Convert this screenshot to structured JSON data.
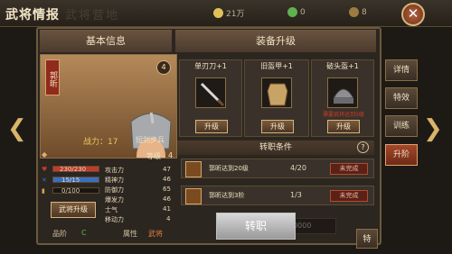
{
  "window": {
    "title": "武将情报",
    "ghost_title": "武将营地"
  },
  "resources": [
    {
      "value": "21万",
      "color": "#e1c25a"
    },
    {
      "value": "0",
      "color": "#5fb14f"
    },
    {
      "value": "8",
      "color": "#9c7c3f"
    }
  ],
  "tabs": {
    "basic": "基本信息",
    "equip": "装备升级"
  },
  "hero": {
    "name": "郭昕",
    "level_badge": "4",
    "power": "战力：17",
    "unit_type": "短剑步兵",
    "grade_label": "等级",
    "grade_value": "4"
  },
  "bars": [
    {
      "value": "230/230",
      "color": "#c23b2a",
      "fill": 1.0
    },
    {
      "value": "15/15",
      "color": "#3a6fbf",
      "fill": 1.0
    },
    {
      "value": "0/100",
      "color": "#cfa352",
      "fill": 0.0
    }
  ],
  "stats": [
    {
      "label": "攻击力",
      "value": "47"
    },
    {
      "label": "精神力",
      "value": "46"
    },
    {
      "label": "防御力",
      "value": "65"
    },
    {
      "label": "爆发力",
      "value": "46"
    },
    {
      "label": "士气",
      "value": "41"
    },
    {
      "label": "移动力",
      "value": "4"
    }
  ],
  "hero_upgrade": "武将升级",
  "bottom": {
    "quality_label": "品阶",
    "quality_value": "C",
    "attribute_label": "属性",
    "attribute_value": "武将"
  },
  "equipment": [
    {
      "name": "单刃刀+1",
      "button": "升级"
    },
    {
      "name": "旧盔甲+1",
      "button": "升级"
    },
    {
      "name": "破头盔+1",
      "button": "升级",
      "note": "需要武将达到5级"
    }
  ],
  "conditions_title": "转职条件",
  "help_icon": "?",
  "conditions": [
    {
      "text": "郭昕达到20级",
      "count": "4/20",
      "state": "未完成"
    },
    {
      "text": "郭昕达到3阶",
      "count": "1/3",
      "state": "未完成"
    }
  ],
  "transfer_button": "转职",
  "transfer_cost": "10000",
  "side_buttons": [
    "详情",
    "特效",
    "训练",
    "升阶"
  ],
  "bottom_side": "特"
}
